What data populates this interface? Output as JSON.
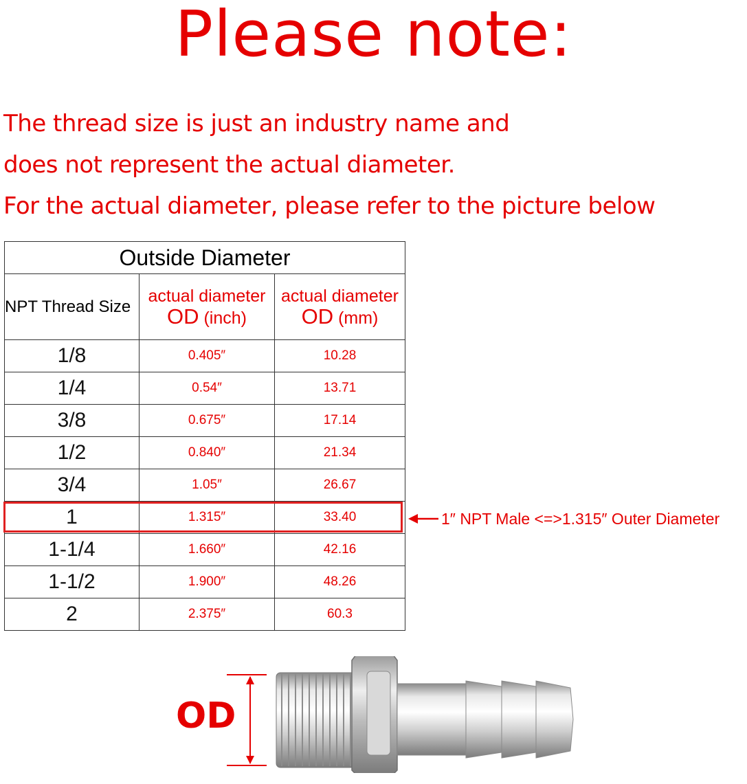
{
  "title": "Please note:",
  "notes": [
    "The thread size is just an industry name and",
    "does not represent the actual diameter.",
    "For the actual diameter, please refer to the picture below"
  ],
  "table": {
    "caption": "Outside Diameter",
    "col1_header": "NPT Thread Size",
    "col2_header_line1": "actual diameter",
    "col2_header_od": "OD",
    "col2_header_unit": "(inch)",
    "col3_header_line1": "actual diameter",
    "col3_header_od": "OD",
    "col3_header_unit": "(mm)",
    "rows": [
      {
        "size": "1/8",
        "inch": "0.405″",
        "mm": "10.28"
      },
      {
        "size": "1/4",
        "inch": "0.54″",
        "mm": "13.71"
      },
      {
        "size": "3/8",
        "inch": "0.675″",
        "mm": "17.14"
      },
      {
        "size": "1/2",
        "inch": "0.840″",
        "mm": "21.34"
      },
      {
        "size": "3/4",
        "inch": "1.05″",
        "mm": "26.67"
      },
      {
        "size": "1",
        "inch": "1.315″",
        "mm": "33.40"
      },
      {
        "size": "1-1/4",
        "inch": "1.660″",
        "mm": "42.16"
      },
      {
        "size": "1-1/2",
        "inch": "1.900″",
        "mm": "48.26"
      },
      {
        "size": "2",
        "inch": "2.375″",
        "mm": "60.3"
      }
    ],
    "highlighted_row": 5
  },
  "callout": "1″  NPT Male <=>1.315″  Outer Diameter",
  "diagram": {
    "od_label": "OD"
  },
  "colors": {
    "accent_red": "#e50000",
    "grid": "#333333",
    "metal": "#c9c9c9"
  }
}
